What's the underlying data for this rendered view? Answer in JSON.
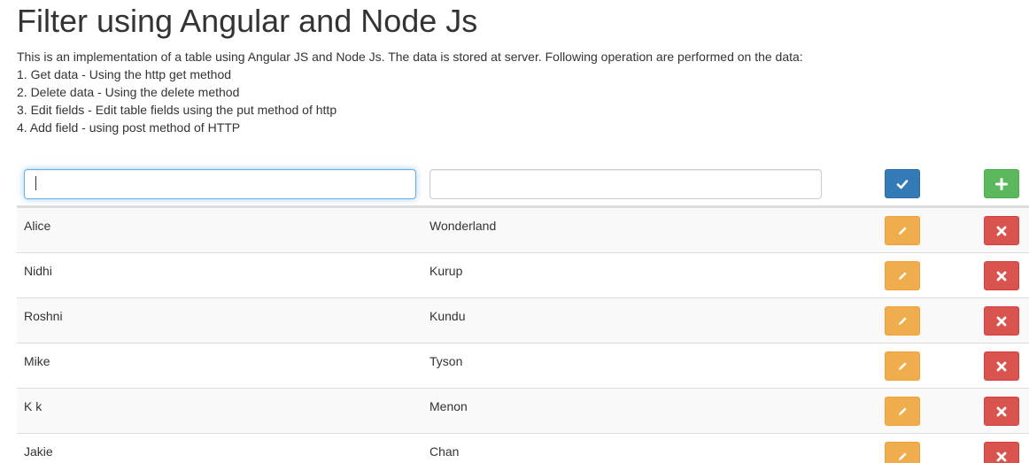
{
  "page": {
    "title": "Filter using Angular and Node Js",
    "description": "This is an implementation of a table using Angular JS and Node Js. The data is stored at server. Following operation are performed on the data:",
    "operations": [
      "1. Get data - Using the http get method",
      "2. Delete data - Using the delete method",
      "3. Edit fields - Edit table fields using the put method of http",
      "4. Add field - using post method of HTTP"
    ]
  },
  "form": {
    "first_name_value": "",
    "last_name_value": "",
    "save_icon": "check-icon",
    "add_icon": "plus-icon"
  },
  "rows": [
    {
      "first": "Alice",
      "last": "Wonderland"
    },
    {
      "first": "Nidhi",
      "last": "Kurup"
    },
    {
      "first": "Roshni",
      "last": "Kundu"
    },
    {
      "first": "Mike",
      "last": "Tyson"
    },
    {
      "first": "K k",
      "last": "Menon"
    },
    {
      "first": "Jakie",
      "last": "Chan"
    }
  ],
  "row_actions": {
    "edit_icon": "pencil-icon",
    "delete_icon": "times-icon"
  },
  "colors": {
    "primary": "#337ab7",
    "success": "#5cb85c",
    "warning": "#f0ad4e",
    "danger": "#d9534f",
    "stripe": "#f9f9f9"
  }
}
